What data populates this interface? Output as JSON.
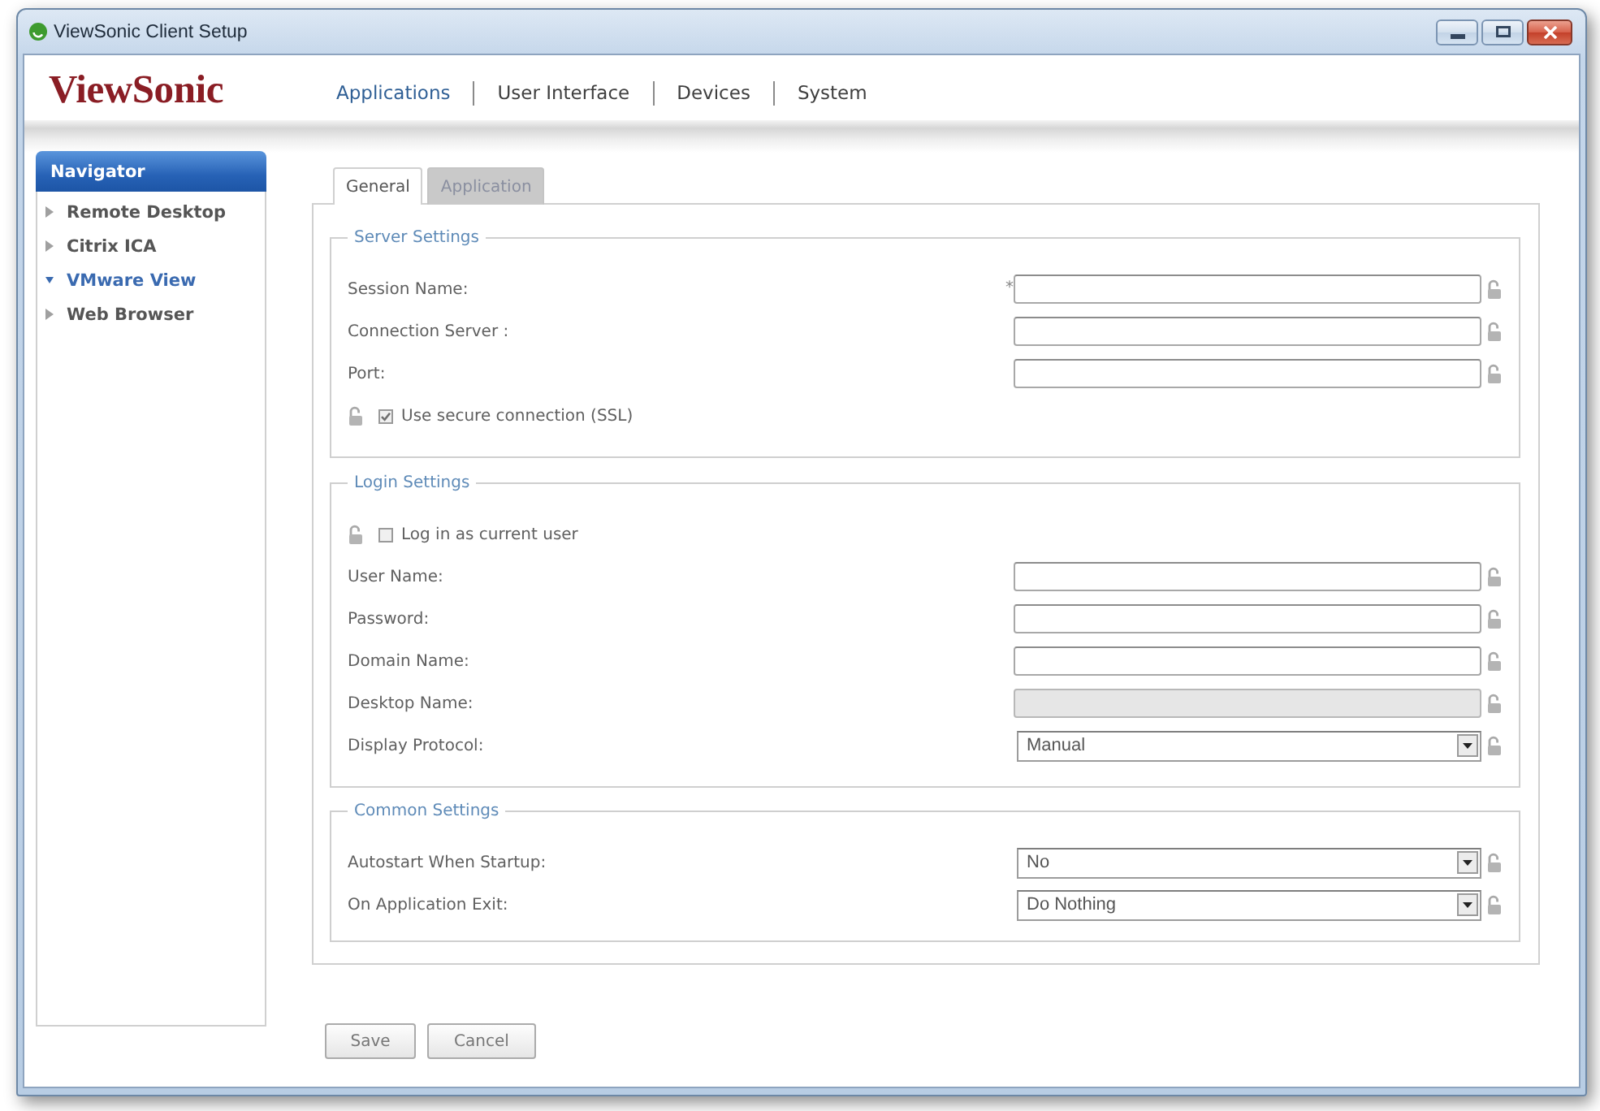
{
  "window": {
    "title": "ViewSonic Client Setup"
  },
  "header": {
    "logo": "ViewSonic",
    "menu": [
      {
        "label": "Applications",
        "selected": true
      },
      {
        "label": "User Interface",
        "selected": false
      },
      {
        "label": "Devices",
        "selected": false
      },
      {
        "label": "System",
        "selected": false
      }
    ]
  },
  "navigator": {
    "title": "Navigator",
    "items": [
      {
        "label": "Remote Desktop",
        "selected": false
      },
      {
        "label": "Citrix ICA",
        "selected": false
      },
      {
        "label": "VMware View",
        "selected": true
      },
      {
        "label": "Web Browser",
        "selected": false
      }
    ]
  },
  "tabs": [
    {
      "label": "General",
      "selected": true
    },
    {
      "label": "Application",
      "selected": false
    }
  ],
  "sections": [
    {
      "title": "Server Settings",
      "rows": [
        {
          "kind": "text",
          "label": "Session Name:",
          "required_mark": "*",
          "disabled": false
        },
        {
          "kind": "text",
          "label": "Connection Server :",
          "disabled": false
        },
        {
          "kind": "text",
          "label": "Port:",
          "disabled": false
        },
        {
          "kind": "checkbox",
          "label": "Use secure connection (SSL)",
          "checked": true
        }
      ]
    },
    {
      "title": "Login Settings",
      "rows": [
        {
          "kind": "checkbox",
          "label": "Log in as current user",
          "checked": false
        },
        {
          "kind": "text",
          "label": "User Name:",
          "disabled": false
        },
        {
          "kind": "text",
          "label": "Password:",
          "disabled": false
        },
        {
          "kind": "text",
          "label": "Domain Name:",
          "disabled": false
        },
        {
          "kind": "text",
          "label": "Desktop Name:",
          "disabled": true
        },
        {
          "kind": "select",
          "label": "Display Protocol:",
          "value": "Manual"
        }
      ]
    },
    {
      "title": "Common Settings",
      "rows": [
        {
          "kind": "select",
          "label": "Autostart When Startup:",
          "value": "No"
        },
        {
          "kind": "select",
          "label": "On Application Exit:",
          "value": "Do Nothing"
        }
      ]
    }
  ],
  "buttons": [
    "Save",
    "Cancel"
  ]
}
